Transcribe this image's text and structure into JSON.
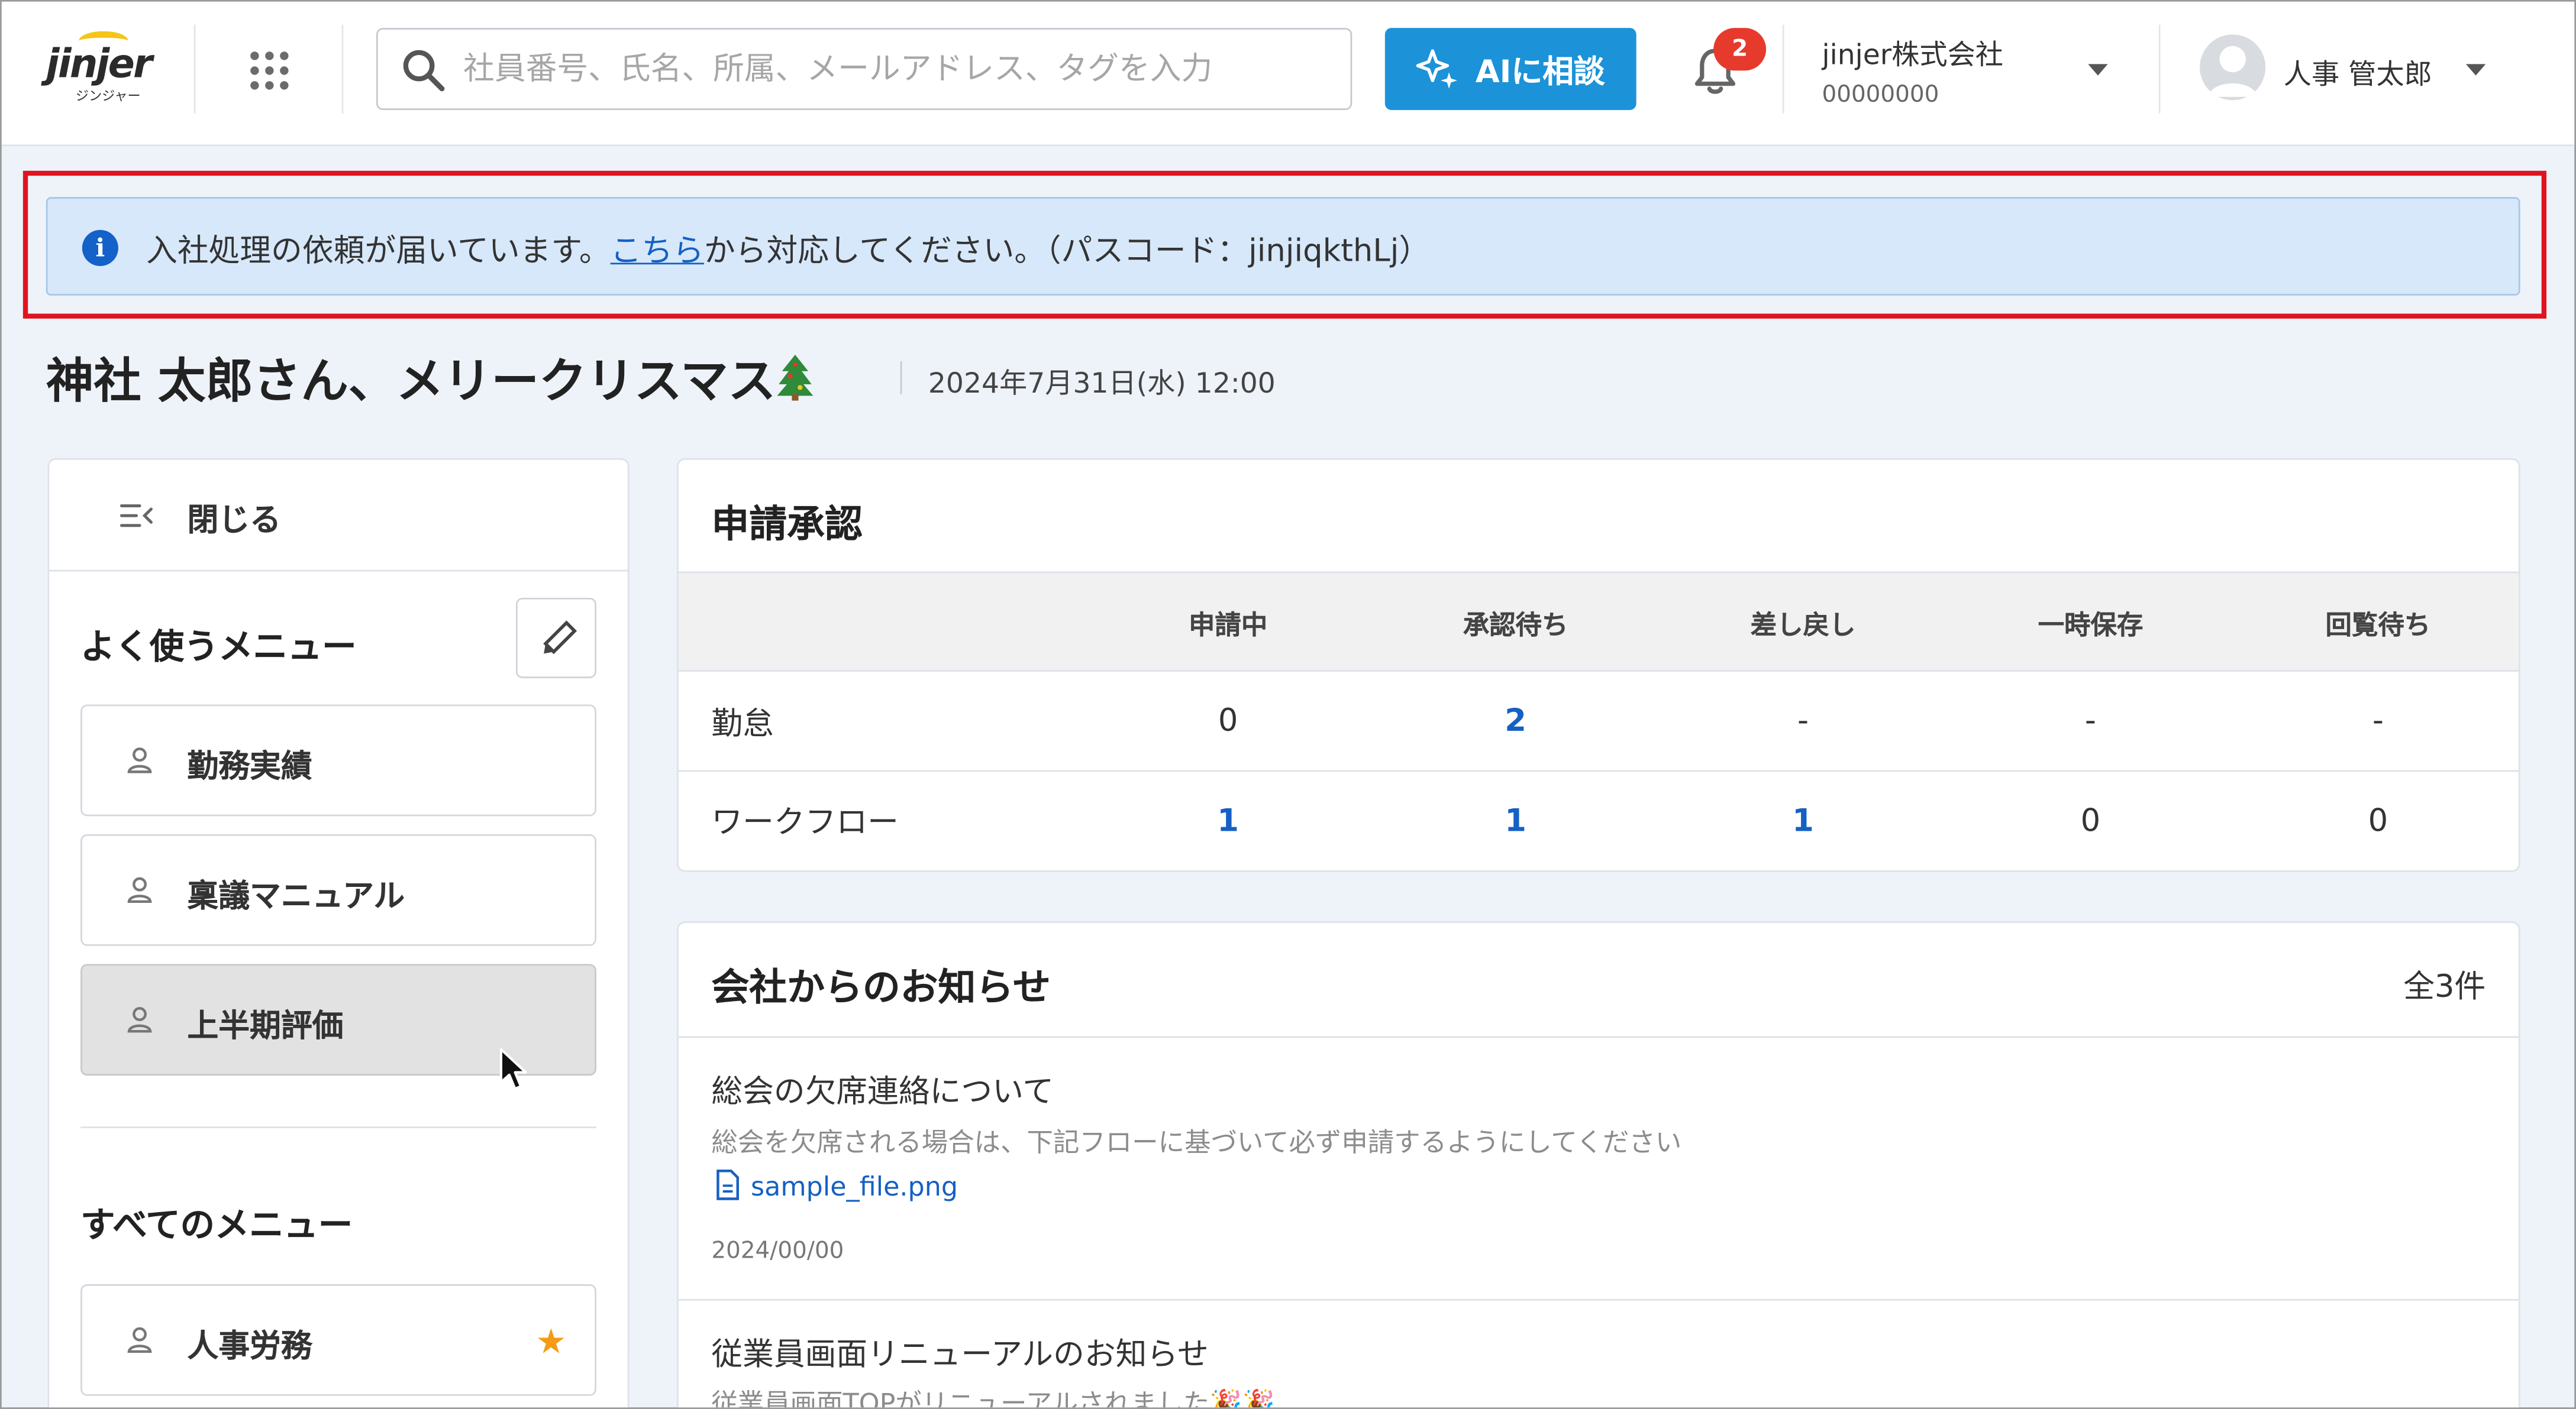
{
  "header": {
    "logo_text": "jinjer",
    "logo_subtext": "ジンジャー",
    "search_placeholder": "社員番号、氏名、所属、メールアドレス、タグを入力",
    "ai_button_label": "AIに相談",
    "notification_count": "2",
    "company_name": "jinjer株式会社",
    "company_id": "00000000",
    "user_name": "人事 管太郎"
  },
  "alert": {
    "text_before": "入社処理の依頼が届いています。",
    "link_text": "こちら",
    "text_after": "から対応してください。（パスコード：jinjiqkthLj）"
  },
  "greeting": {
    "message": "神社 太郎さん、メリークリスマス",
    "datetime": "2024年7月31日(水) 12:00"
  },
  "sidebar": {
    "close_label": "閉じる",
    "favorites_heading": "よく使うメニュー",
    "favorites": [
      {
        "label": "勤務実績"
      },
      {
        "label": "稟議マニュアル"
      },
      {
        "label": "上半期評価"
      }
    ],
    "all_heading": "すべてのメニュー",
    "all_items": [
      {
        "label": "人事労務"
      }
    ]
  },
  "approvals": {
    "title": "申請承認",
    "columns": [
      "申請中",
      "承認待ち",
      "差し戻し",
      "一時保存",
      "回覧待ち"
    ],
    "rows": [
      {
        "label": "勤怠",
        "values": [
          "0",
          "2",
          "-",
          "-",
          "-"
        ]
      },
      {
        "label": "ワークフロー",
        "values": [
          "1",
          "1",
          "1",
          "0",
          "0"
        ]
      }
    ]
  },
  "notices": {
    "title": "会社からのお知らせ",
    "count": "全3件",
    "items": [
      {
        "title": "総会の欠席連絡について",
        "body": "総会を欠席される場合は、下記フローに基づいて必ず申請するようにしてください",
        "file": "sample_file.png",
        "date": "2024/00/00"
      },
      {
        "title": "従業員画面リニューアルのお知らせ",
        "body": "従業員画面TOPがリニューアルされました🎉🎉"
      }
    ]
  },
  "colors": {
    "accent": "#1c92d8",
    "link": "#1560c4",
    "alert_bg": "#d7e8fa",
    "badge": "#e53a2c",
    "highlight_frame": "#e0141e",
    "star": "#f39b16"
  }
}
